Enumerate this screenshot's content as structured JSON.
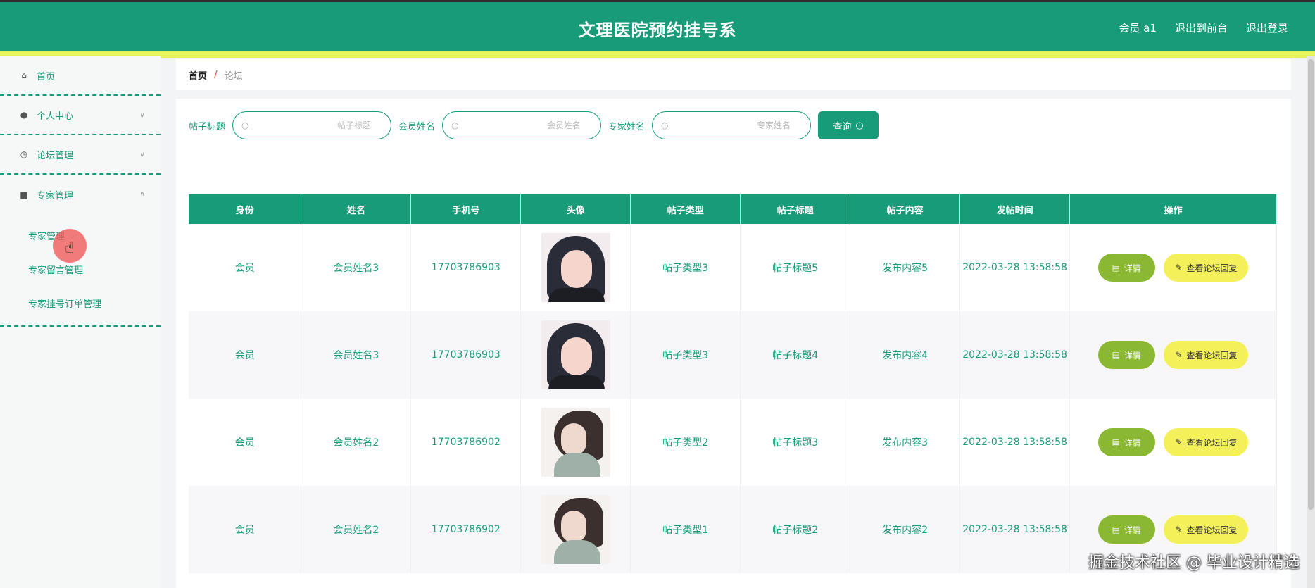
{
  "header": {
    "title": "文理医院预约挂号系",
    "user_label": "会员 a1",
    "front_link": "退出到前台",
    "logout": "退出登录"
  },
  "sidebar": {
    "items": [
      {
        "label": "首页",
        "icon": "home-icon"
      },
      {
        "label": "个人中心",
        "icon": "user-icon"
      },
      {
        "label": "论坛管理",
        "icon": "clock-icon"
      },
      {
        "label": "专家管理",
        "icon": "printer-icon"
      }
    ],
    "sub_items": [
      "专家管理",
      "专家留言管理",
      "专家挂号订单管理"
    ]
  },
  "breadcrumb": {
    "home": "首页",
    "separator": "/",
    "current": "论坛"
  },
  "search": {
    "title_label": "帖子标题",
    "title_placeholder": "帖子标题",
    "name_label": "会员姓名",
    "name_placeholder": "会员姓名",
    "expert_label": "专家姓名",
    "expert_placeholder": "专家姓名",
    "query_button": "查询"
  },
  "table": {
    "columns": [
      "身份",
      "姓名",
      "手机号",
      "头像",
      "帖子类型",
      "帖子标题",
      "帖子内容",
      "发帖时间",
      "操作"
    ],
    "rows": [
      {
        "identity": "会员",
        "name": "会员姓名3",
        "phone": "17703786903",
        "avatar": "avatar-a",
        "type": "帖子类型3",
        "title": "帖子标题5",
        "content": "发布内容5",
        "time": "2022-03-28 13:58:58"
      },
      {
        "identity": "会员",
        "name": "会员姓名3",
        "phone": "17703786903",
        "avatar": "avatar-a",
        "type": "帖子类型3",
        "title": "帖子标题4",
        "content": "发布内容4",
        "time": "2022-03-28 13:58:58"
      },
      {
        "identity": "会员",
        "name": "会员姓名2",
        "phone": "17703786902",
        "avatar": "avatar-b",
        "type": "帖子类型2",
        "title": "帖子标题3",
        "content": "发布内容3",
        "time": "2022-03-28 13:58:58"
      },
      {
        "identity": "会员",
        "name": "会员姓名2",
        "phone": "17703786902",
        "avatar": "avatar-b",
        "type": "帖子类型1",
        "title": "帖子标题2",
        "content": "发布内容2",
        "time": "2022-03-28 13:58:58"
      }
    ],
    "detail_button": "详情",
    "reply_button": "查看论坛回复"
  },
  "watermark": "掘金技术社区 @ 毕业设计精选",
  "colors": {
    "primary": "#179b79",
    "accent_yellow": "#e8f55a",
    "detail_green": "#8ab832",
    "reply_yellow": "#f4f05a"
  }
}
